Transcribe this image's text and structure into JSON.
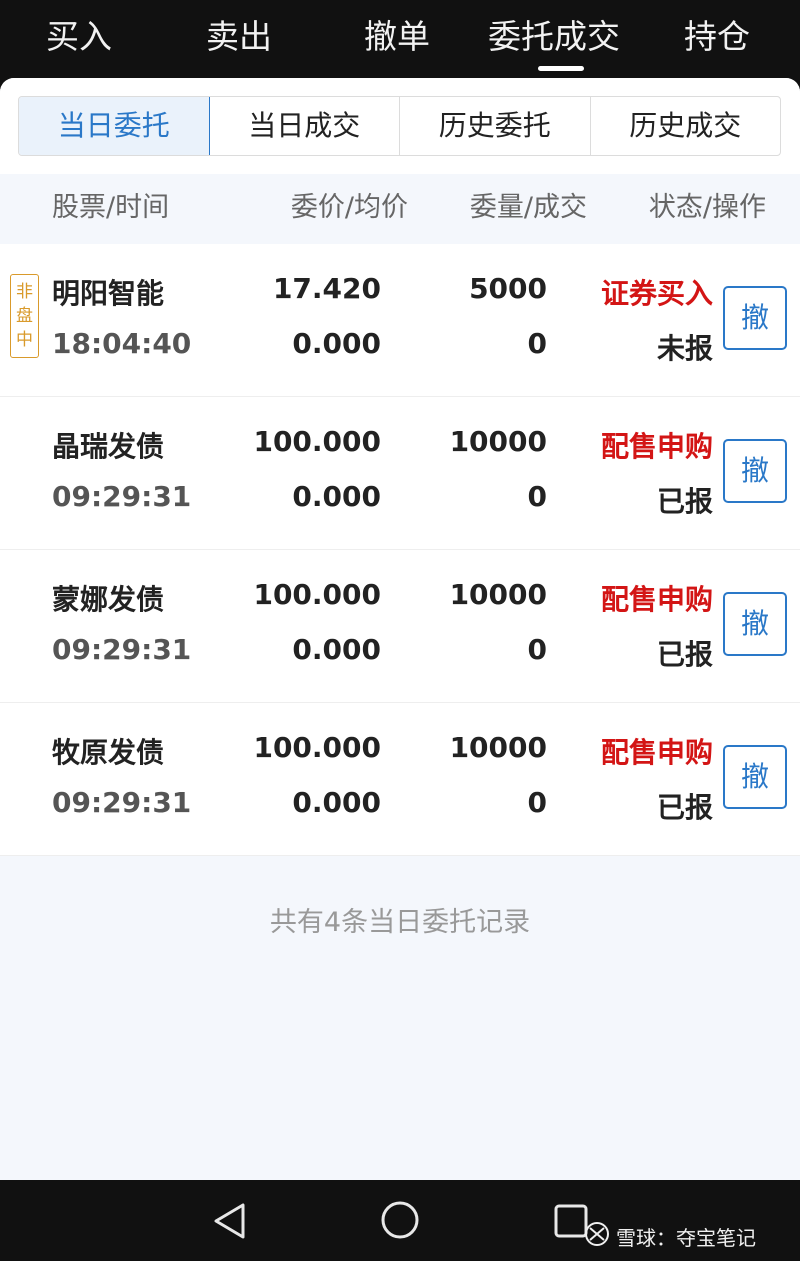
{
  "nav": {
    "tabs": [
      "买入",
      "卖出",
      "撤单",
      "委托成交",
      "持仓"
    ],
    "active_index": 3
  },
  "segments": {
    "items": [
      "当日委托",
      "当日成交",
      "历史委托",
      "历史成交"
    ],
    "active_index": 0
  },
  "columns": {
    "stock_time": "股票/时间",
    "price_avg": "委价/均价",
    "qty_filled": "委量/成交",
    "status_action": "状态/操作"
  },
  "orders": [
    {
      "badge": [
        "非",
        "盘",
        "中"
      ],
      "name": "明阳智能",
      "time": "18:04:40",
      "price": "17.420",
      "avg_price": "0.000",
      "qty": "5000",
      "filled": "0",
      "type": "证券买入",
      "status": "未报",
      "cancel_label": "撤"
    },
    {
      "name": "晶瑞发债",
      "time": "09:29:31",
      "price": "100.000",
      "avg_price": "0.000",
      "qty": "10000",
      "filled": "0",
      "type": "配售申购",
      "status": "已报",
      "cancel_label": "撤"
    },
    {
      "name": "蒙娜发债",
      "time": "09:29:31",
      "price": "100.000",
      "avg_price": "0.000",
      "qty": "10000",
      "filled": "0",
      "type": "配售申购",
      "status": "已报",
      "cancel_label": "撤"
    },
    {
      "name": "牧原发债",
      "time": "09:29:31",
      "price": "100.000",
      "avg_price": "0.000",
      "qty": "10000",
      "filled": "0",
      "type": "配售申购",
      "status": "已报",
      "cancel_label": "撤"
    }
  ],
  "summary": "共有4条当日委托记录",
  "system_nav": {
    "back_icon": "triangle-back-icon",
    "home_icon": "circle-home-icon",
    "recent_icon": "square-recent-apps-icon"
  },
  "watermark": {
    "text": "雪球：夺宝笔记"
  },
  "colors": {
    "accent": "#2a78c8",
    "sell_red": "#d31515",
    "badge_orange": "#d99a2b",
    "background": "#f4f7fc"
  }
}
